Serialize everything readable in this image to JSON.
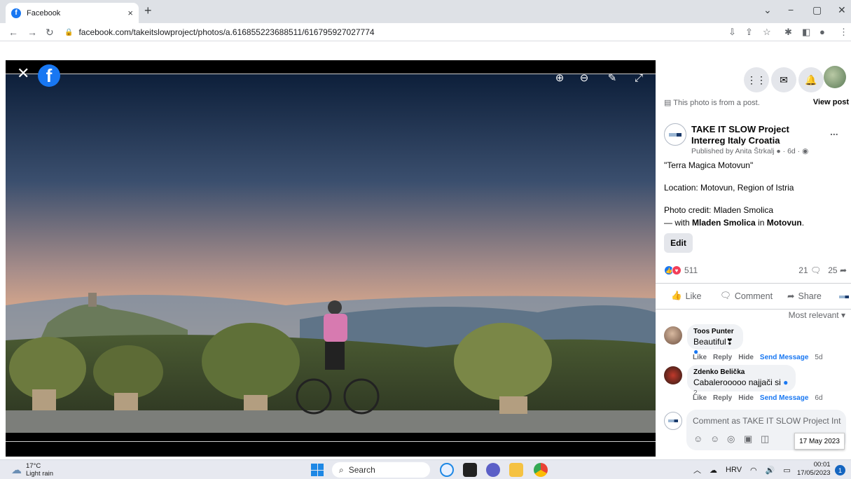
{
  "browser": {
    "tab_title": "Facebook",
    "tab_close": "×",
    "new_tab": "+",
    "url": "facebook.com/takeitslowproject/photos/a.616855223688511/616795927027774",
    "window_controls": [
      "⌄",
      "−",
      "▢",
      "✕"
    ]
  },
  "viewer": {
    "close_label": "✕",
    "logo_letter": "f",
    "tools": [
      "zoom-in-icon",
      "zoom-out-icon",
      "tag-icon",
      "fullscreen-icon"
    ]
  },
  "panel": {
    "from_post_text": "This photo is from a post.",
    "view_post_label": "View post",
    "page_name": "TAKE IT SLOW Project Interreg Italy Croatia",
    "more_label": "...",
    "published_by": "Published by Anita Štrkalj",
    "published_age": "· 6d ·",
    "caption_title": "\"Terra Magica Motovun\"",
    "location": "Location: Motovun, Region of Istria",
    "credit": "Photo credit: Mladen Smolica",
    "with_prefix": "— with ",
    "with_name": "Mladen Smolica",
    "with_in": " in ",
    "with_place": "Motovun",
    "with_end": ".",
    "edit_label": "Edit",
    "reactions_count": "511",
    "comments_count": "21",
    "shares_count": "25",
    "like_label": "Like",
    "comment_label": "Comment",
    "share_label": "Share",
    "sort_label": "Most relevant",
    "comments": [
      {
        "name": "Toos Punter",
        "text": "Beautiful❣",
        "react_count": "",
        "actions": [
          "Like",
          "Reply",
          "Hide",
          "Send Message"
        ],
        "age": "5d"
      },
      {
        "name": "Zdenko Belička",
        "text": "Cabalerooooo najjači si",
        "react_count": "2",
        "actions": [
          "Like",
          "Reply",
          "Hide",
          "Send Message"
        ],
        "age": "6d"
      }
    ],
    "composer_placeholder": "Comment as TAKE IT SLOW Project Int...",
    "tooltip_date": "17 May 2023"
  },
  "taskbar": {
    "temp": "17°C",
    "weather": "Light rain",
    "search_label": "Search",
    "lang": "HRV",
    "time": "00:01",
    "date": "17/05/2023",
    "notif_count": "1"
  },
  "colors": {
    "fb_blue": "#1877f2",
    "like_red": "#f33e58"
  }
}
